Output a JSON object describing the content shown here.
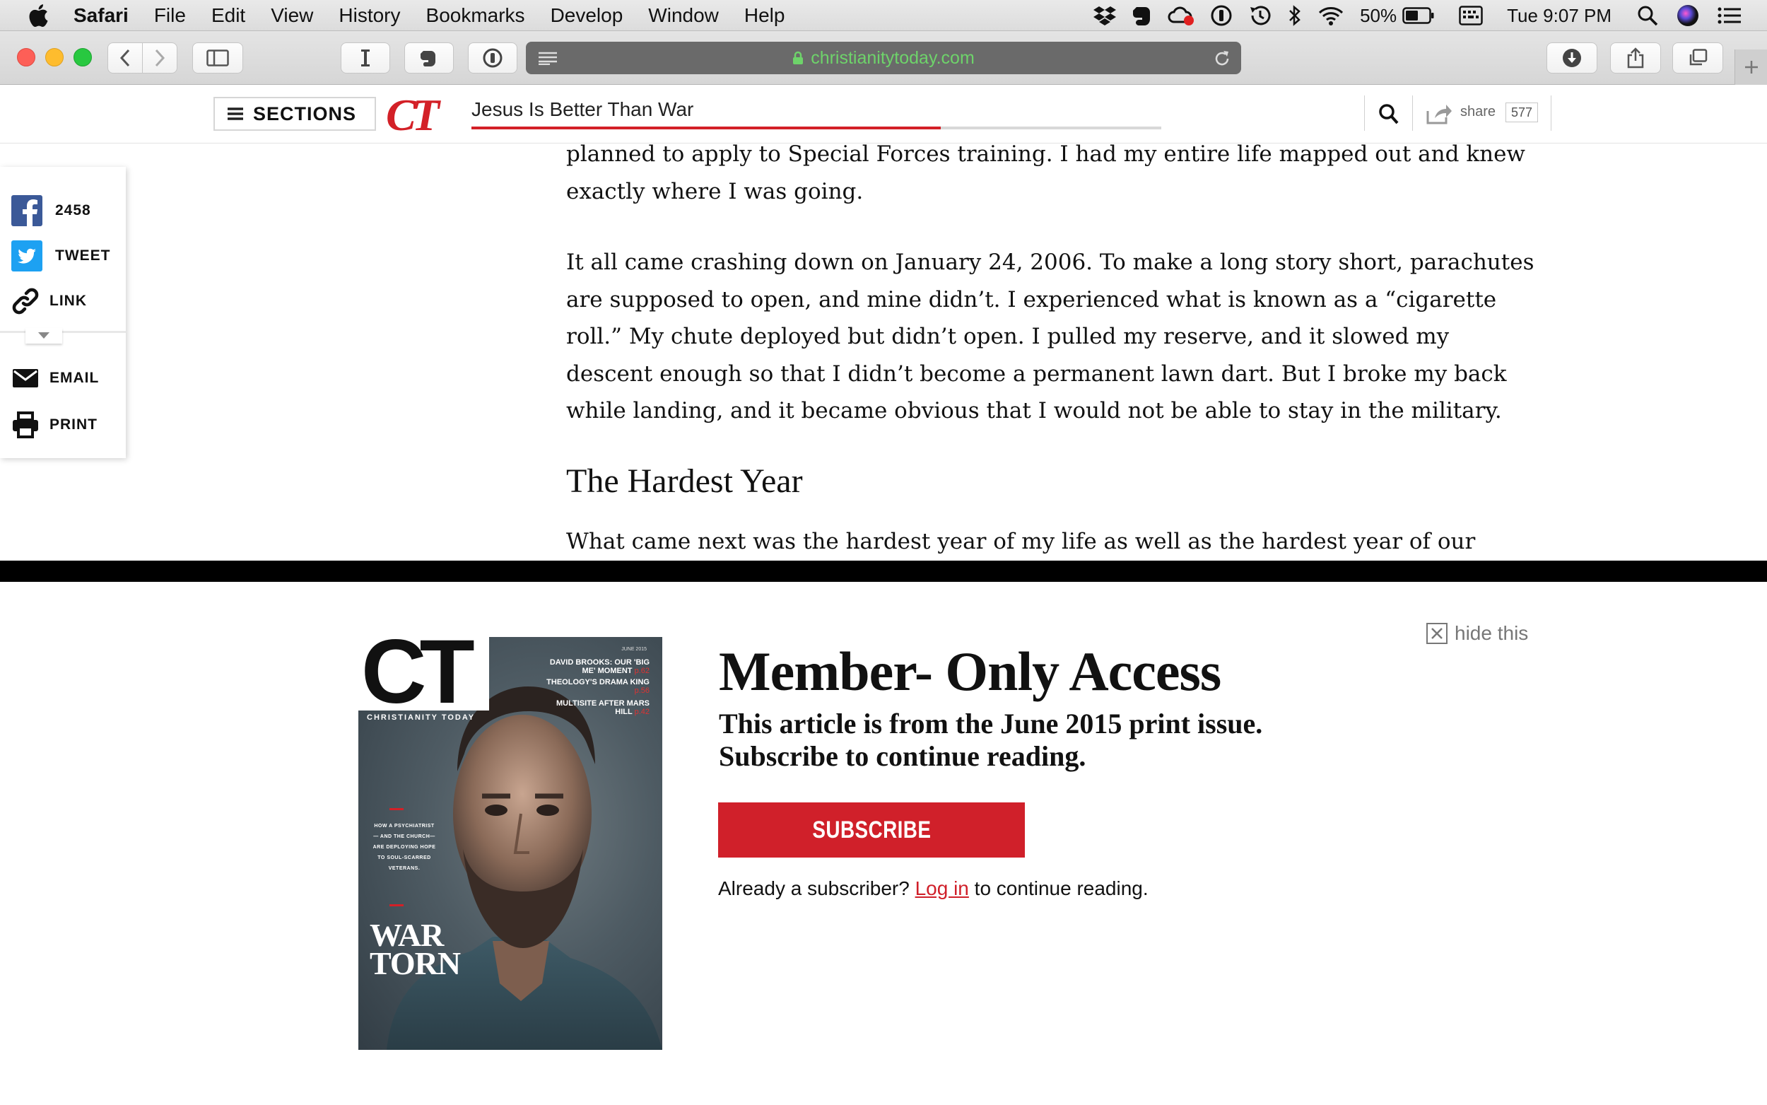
{
  "menubar": {
    "app_name": "Safari",
    "items": [
      "File",
      "Edit",
      "View",
      "History",
      "Bookmarks",
      "Develop",
      "Window",
      "Help"
    ],
    "battery_percent": "50%",
    "clock": "Tue 9:07 PM"
  },
  "browser": {
    "url": "christianitytoday.com"
  },
  "site_header": {
    "sections_label": "SECTIONS",
    "logo_text": "CT",
    "article_title": "Jesus Is Better Than War",
    "reading_progress": 0.68,
    "share_label": "share",
    "share_count": "577"
  },
  "social_rail": {
    "facebook_count": "2458",
    "tweet_label": "TWEET",
    "link_label": "LINK",
    "email_label": "EMAIL",
    "print_label": "PRINT"
  },
  "article": {
    "paragraph_1": "planned to apply to Special Forces training. I had my entire life mapped out and knew exactly where I was going.",
    "paragraph_2": "It all came crashing down on January 24, 2006. To make a long story short, parachutes are supposed to open, and mine didn’t. I experienced what is known as a “cigarette roll.” My chute deployed but didn’t open. I pulled my reserve, and it slowed my descent enough so that I didn’t become a permanent lawn dart. But I broke my back while landing, and it became obvious that I would not be able to stay in the military.",
    "heading": "The Hardest Year",
    "paragraph_3": "What came next was the hardest year of my life as well as the hardest year of our"
  },
  "paywall": {
    "hide_label": "hide this",
    "title": "Member- Only Access",
    "subtitle_line_1": "This article is from the June 2015 print issue.",
    "subtitle_line_2": "Subscribe to continue reading.",
    "subscribe_label": "SUBSCRIBE",
    "already_prefix": "Already a subscriber?",
    "login_label": "Log in",
    "already_suffix": "to continue reading."
  },
  "magazine_cover": {
    "logo": "CT",
    "name": "CHRISTIANITY TODAY",
    "date": "JUNE 2015",
    "teasers": [
      {
        "text": "DAVID BROOKS: OUR 'BIG ME' MOMENT",
        "page": "p.62"
      },
      {
        "text": "THEOLOGY'S DRAMA KING",
        "page": "p.56"
      },
      {
        "text": "MULTISITE AFTER MARS HILL",
        "page": "p.42"
      }
    ],
    "side_note": "HOW A PSYCHIATRIST— AND THE CHURCH— ARE DEPLOYING HOPE TO SOUL-SCARRED VETERANS.",
    "headline_line_1": "WAR",
    "headline_line_2": "TORN"
  },
  "colors": {
    "brand_red": "#d32027",
    "url_green": "#6ed36a"
  }
}
